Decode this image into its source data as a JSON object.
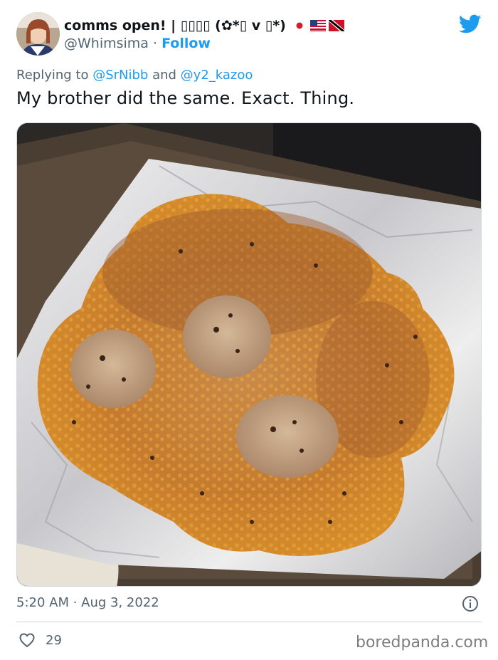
{
  "author": {
    "display_name": "comms open! | ▯▯▯▯ (✿*▯ v ▯*)",
    "handle": "@Whimsima",
    "separator": " · ",
    "follow_label": "Follow",
    "flags": [
      "japan-flag-icon",
      "usa-flag-icon",
      "trinidad-flag-icon"
    ],
    "avatar": "avatar"
  },
  "reply": {
    "prefix": "Replying to ",
    "mention_1": "@SrNibb",
    "joiner": " and ",
    "mention_2": "@y2_kazoo"
  },
  "tweet": {
    "text": "My brother did the same. Exact. Thing.",
    "timestamp": "5:20 AM · Aug 3, 2022"
  },
  "actions": {
    "like_count": "29"
  },
  "watermark": "boredpanda.com",
  "colors": {
    "twitter_blue": "#1d9bf0",
    "text_primary": "#0f1419",
    "text_secondary": "#536471",
    "divider": "#cfd9de"
  },
  "icons": {
    "brand": "twitter-bird-icon",
    "info": "info-icon",
    "like": "heart-icon"
  }
}
